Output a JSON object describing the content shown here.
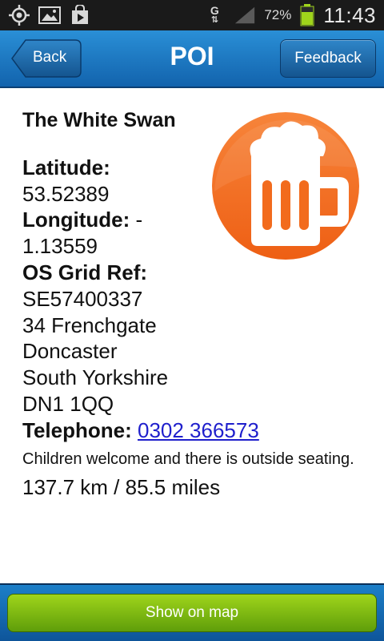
{
  "status_bar": {
    "battery_percent": "72%",
    "time": "11:43",
    "network_letter": "G",
    "icons": [
      "gps-icon",
      "gallery-icon",
      "play-store-icon",
      "network-icon",
      "signal-icon",
      "battery-icon"
    ]
  },
  "header": {
    "title": "POI",
    "back_label": "Back",
    "feedback_label": "Feedback"
  },
  "poi": {
    "name": "The White Swan",
    "latitude_label": "Latitude:",
    "latitude_value": "53.52389",
    "longitude_label": "Longitude:",
    "longitude_value_part1": " -",
    "longitude_value_part2": "1.13559",
    "grid_label": "OS Grid Ref:",
    "grid_value": "SE57400337",
    "address": [
      "34 Frenchgate",
      "Doncaster",
      "South Yorkshire",
      "DN1 1QQ"
    ],
    "telephone_label": "Telephone:",
    "telephone_value": "0302 366573",
    "description": "Children welcome and there is outside seating.",
    "distance": "137.7 km / 85.5 miles",
    "category_icon": "beer-mug-icon"
  },
  "footer": {
    "show_map_label": "Show on map"
  },
  "colors": {
    "header_blue": "#1a78c2",
    "beer_orange": "#f26b1d",
    "button_green": "#7fbc14",
    "link_blue": "#1f1fcc"
  }
}
